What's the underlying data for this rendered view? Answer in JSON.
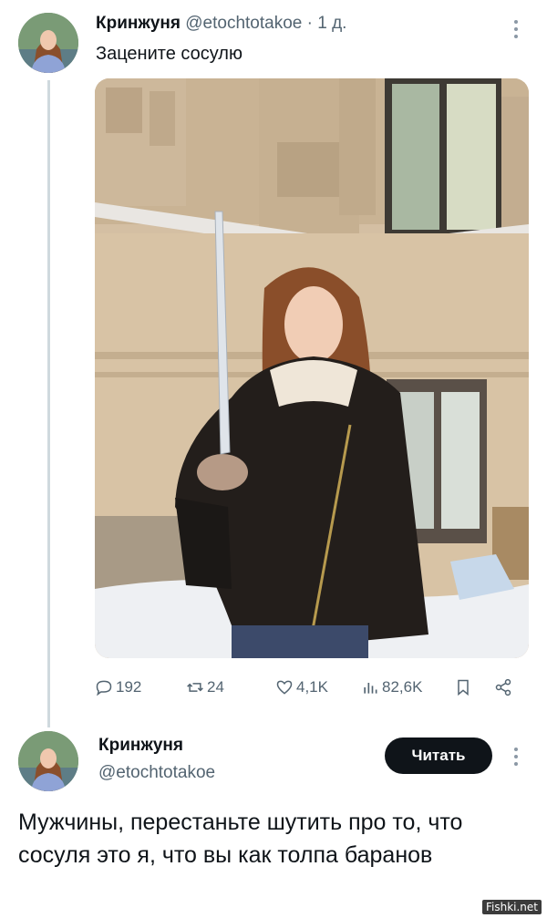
{
  "tweet": {
    "author_name": "Кринжуня",
    "author_handle": "@etochtotakoe",
    "separator": "·",
    "time": "1 д.",
    "text": "Зацените сосулю",
    "stats": {
      "replies": "192",
      "reposts": "24",
      "likes": "4,1K",
      "views": "82,6K"
    }
  },
  "profile_card": {
    "name": "Кринжуня",
    "handle": "@etochtotakoe",
    "follow_label": "Читать",
    "bio": "Мужчины, перестаньте шутить про то, что сосуля это я, что вы как толпа баранов"
  },
  "watermark": "Fishki.net",
  "icons": {
    "reply": "reply-icon",
    "repost": "repost-icon",
    "like": "heart-icon",
    "views": "views-icon",
    "bookmark": "bookmark-icon",
    "share": "share-icon",
    "more": "more-vertical-icon"
  },
  "colors": {
    "text_primary": "#0f1419",
    "text_secondary": "#536471",
    "thread_line": "#cfd9de",
    "button_bg": "#0f1419"
  }
}
